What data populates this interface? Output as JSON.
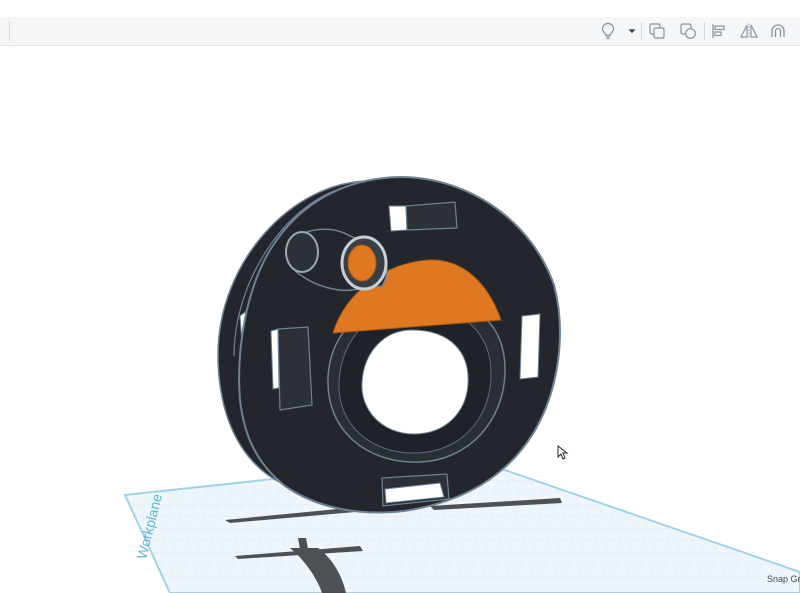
{
  "toolbar": {
    "icons": [
      "lightbulb-icon",
      "dropdown-caret-icon",
      "group-icon",
      "ungroup-icon",
      "align-icon",
      "mirror-icon",
      "cruise-magnet-icon"
    ]
  },
  "viewport": {
    "workplane_label": "Workplane",
    "snap_grid_label": "Snap Grid"
  },
  "colors": {
    "spool_body": "#23272d",
    "spool_edge": "#6d8293",
    "orange_part": "#e07821",
    "workplane_fill": "#eef6fb",
    "workplane_edge": "#9fd2e6",
    "toolbar_bg": "#f4f6f8"
  }
}
